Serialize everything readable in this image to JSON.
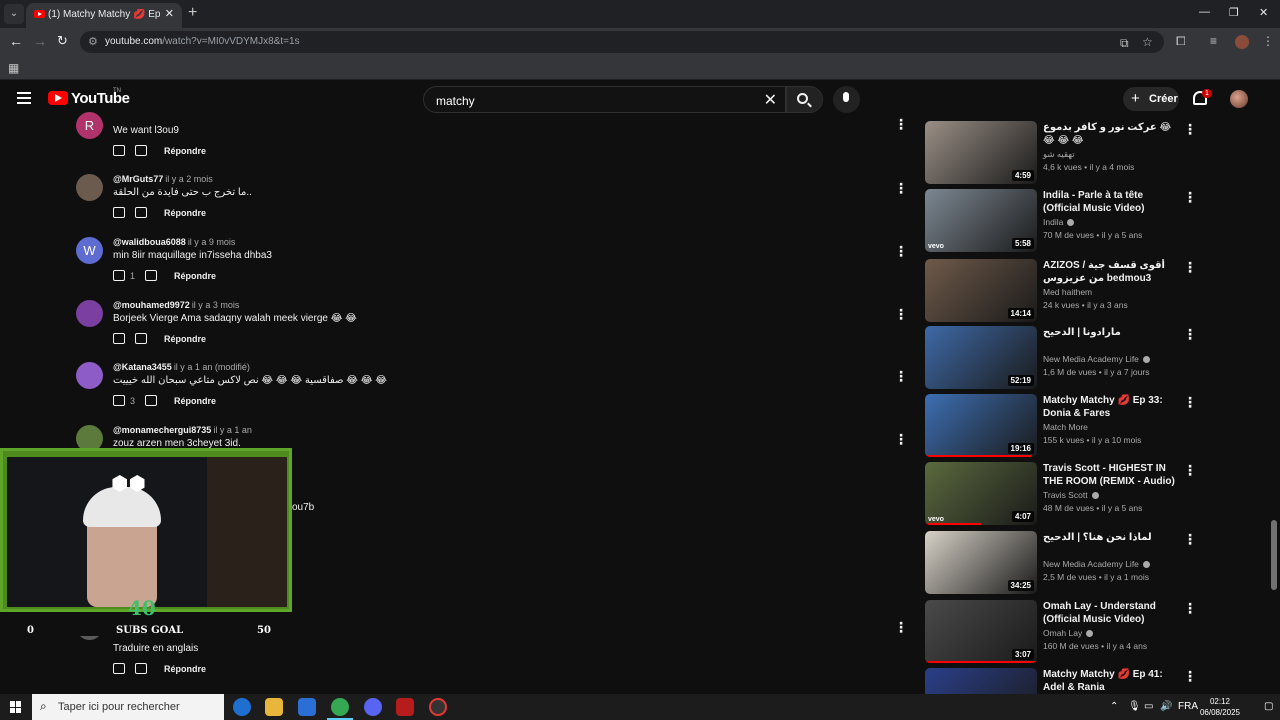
{
  "browser": {
    "tab_title": "(1) Matchy Matchy 💋 Ep 24: H",
    "url_host": "youtube.com",
    "url_path": "/watch?v=MI0vVDYMJx8&t=1s"
  },
  "youtube": {
    "logo_text": "YouTube",
    "country_code": "TN",
    "search_value": "matchy",
    "create_label": "Créer",
    "notification_count": "1"
  },
  "comments": [
    {
      "author": "",
      "time": "",
      "avatar_letter": "R",
      "avatar_color": "#b0336b",
      "text": "We want l3ou9",
      "likes": "",
      "reply": "Répondre"
    },
    {
      "author": "@MrGuts77",
      "time": "il y a 2 mois",
      "avatar_letter": "",
      "avatar_color": "#6b5a4e",
      "text": "ما تخرج ب حتى فايدة من الحلقة..",
      "likes": "",
      "reply": "Répondre"
    },
    {
      "author": "@walidboua6088",
      "time": "il y a 9 mois",
      "avatar_letter": "W",
      "avatar_color": "#5e6bd0",
      "text": "min 8iir maquillage in7isseha dhba3",
      "likes": "1",
      "reply": "Répondre"
    },
    {
      "author": "@mouhamed9972",
      "time": "il y a 3 mois",
      "avatar_letter": "",
      "avatar_color": "#7a3fa0",
      "text": "Borjeek Vierge Ama sadaqny walah meek vierge 😂 😂",
      "likes": "",
      "reply": "Répondre"
    },
    {
      "author": "@Katana3455",
      "time": "il y a 1 an (modifié)",
      "avatar_letter": "",
      "avatar_color": "#8e5cc7",
      "text": "صفاقسية 😂 😂 😂 نص لاكس متاعي سبحان الله خيييت 😂 😂 😂",
      "likes": "3",
      "reply": "Répondre"
    },
    {
      "author": "@monamechergui8735",
      "time": "il y a 1 an",
      "avatar_letter": "",
      "avatar_color": "#5b7a3b",
      "text": "zouz arzen men 3cheyet 3id.",
      "likes": "",
      "reply": ""
    },
    {
      "author": "@Spyreex",
      "time": "il y a 1 an",
      "avatar_letter": "",
      "avatar_color": "#5a5a5a",
      "text": "",
      "likes": "",
      "reply": "Répondre",
      "translate": "Traduire en anglais"
    }
  ],
  "overflow_text": "ou7b",
  "recommendations": [
    {
      "title": "عركت نور و كافر بدموع 😂 😂 😂 😂",
      "channel": "تهقيه شو",
      "verified": false,
      "views": "4,6 k vues",
      "age": "il y a 4 mois",
      "duration": "4:59",
      "thumb_color": "#9a8f86",
      "vevo": false,
      "watched": 0
    },
    {
      "title": "Indila - Parle à ta tête (Official Music Video)",
      "channel": "Indila",
      "verified": true,
      "views": "70 M de vues",
      "age": "il y a 5 ans",
      "duration": "5:58",
      "thumb_color": "#7d8893",
      "vevo": true,
      "watched": 0
    },
    {
      "title": "AZIZOS / أقوى قسف جية من عزيزوس bedmou3 للحيات",
      "channel": "Med haithem",
      "verified": false,
      "views": "24 k vues",
      "age": "il y a 3 ans",
      "duration": "14:14",
      "thumb_color": "#6f5a4a",
      "vevo": false,
      "watched": 0
    },
    {
      "title": "مارادونا | الدحيح",
      "channel": "New Media Academy Life",
      "verified": true,
      "views": "1,6 M de vues",
      "age": "il y a 7 jours",
      "duration": "52:19",
      "thumb_color": "#3e6aa8",
      "vevo": false,
      "watched": 0
    },
    {
      "title": "Matchy Matchy 💋 Ep 33: Donia & Fares",
      "channel": "Match More",
      "verified": false,
      "views": "155 k vues",
      "age": "il y a 10 mois",
      "duration": "19:16",
      "thumb_color": "#3d6fb3",
      "vevo": false,
      "watched": 0.95
    },
    {
      "title": "Travis Scott - HIGHEST IN THE ROOM (REMIX - Audio) ft. ...",
      "channel": "Travis Scott",
      "verified": true,
      "views": "48 M de vues",
      "age": "il y a 5 ans",
      "duration": "4:07",
      "thumb_color": "#5b6a3e",
      "vevo": true,
      "watched": 0.5
    },
    {
      "title": "لماذا نحن هنا؟ | الدحيح",
      "channel": "New Media Academy Life",
      "verified": true,
      "views": "2,5 M de vues",
      "age": "il y a 1 mois",
      "duration": "34:25",
      "thumb_color": "#d8d2c8",
      "vevo": false,
      "watched": 0
    },
    {
      "title": "Omah Lay - Understand (Official Music Video)",
      "channel": "Omah Lay",
      "verified": true,
      "views": "160 M de vues",
      "age": "il y a 4 ans",
      "duration": "3:07",
      "thumb_color": "#4a4a4a",
      "vevo": false,
      "watched": 1
    },
    {
      "title": "Matchy Matchy 💋 Ep 41: Adel & Rania",
      "channel": "",
      "verified": false,
      "views": "",
      "age": "",
      "duration": "",
      "thumb_color": "#2a3f8a",
      "vevo": false,
      "watched": 0
    }
  ],
  "stream_overlay": {
    "goal_label": "SUBS GOAL",
    "goal_min": "0",
    "goal_max": "50",
    "goal_current": "40"
  },
  "taskbar": {
    "search_placeholder": "Taper ici pour rechercher",
    "language": "FRA",
    "time": "02:12",
    "date": "06/08/2025"
  }
}
